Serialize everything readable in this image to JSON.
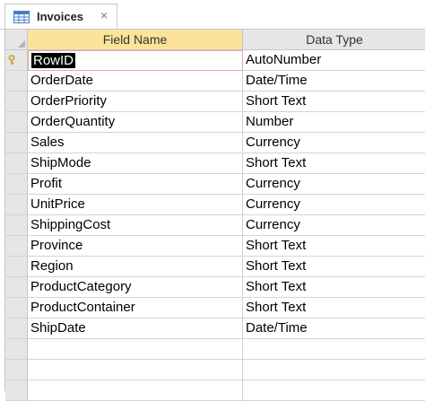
{
  "tab": {
    "title": "Invoices",
    "close": "×"
  },
  "columns": {
    "field_name": "Field Name",
    "data_type": "Data Type"
  },
  "rows": [
    {
      "field": "RowID",
      "type": "AutoNumber",
      "primary_key": true
    },
    {
      "field": "OrderDate",
      "type": "Date/Time"
    },
    {
      "field": "OrderPriority",
      "type": "Short Text"
    },
    {
      "field": "OrderQuantity",
      "type": "Number"
    },
    {
      "field": "Sales",
      "type": "Currency"
    },
    {
      "field": "ShipMode",
      "type": "Short Text"
    },
    {
      "field": "Profit",
      "type": "Currency"
    },
    {
      "field": "UnitPrice",
      "type": "Currency"
    },
    {
      "field": "ShippingCost",
      "type": "Currency"
    },
    {
      "field": "Province",
      "type": "Short Text"
    },
    {
      "field": "Region",
      "type": "Short Text"
    },
    {
      "field": "ProductCategory",
      "type": "Short Text"
    },
    {
      "field": "ProductContainer",
      "type": "Short Text"
    },
    {
      "field": "ShipDate",
      "type": "Date/Time"
    },
    {
      "field": "",
      "type": ""
    },
    {
      "field": "",
      "type": ""
    },
    {
      "field": "",
      "type": ""
    }
  ],
  "colors": {
    "header_active": "#fbe39a",
    "key_icon": "#c8a22a",
    "selection": "#000000"
  }
}
